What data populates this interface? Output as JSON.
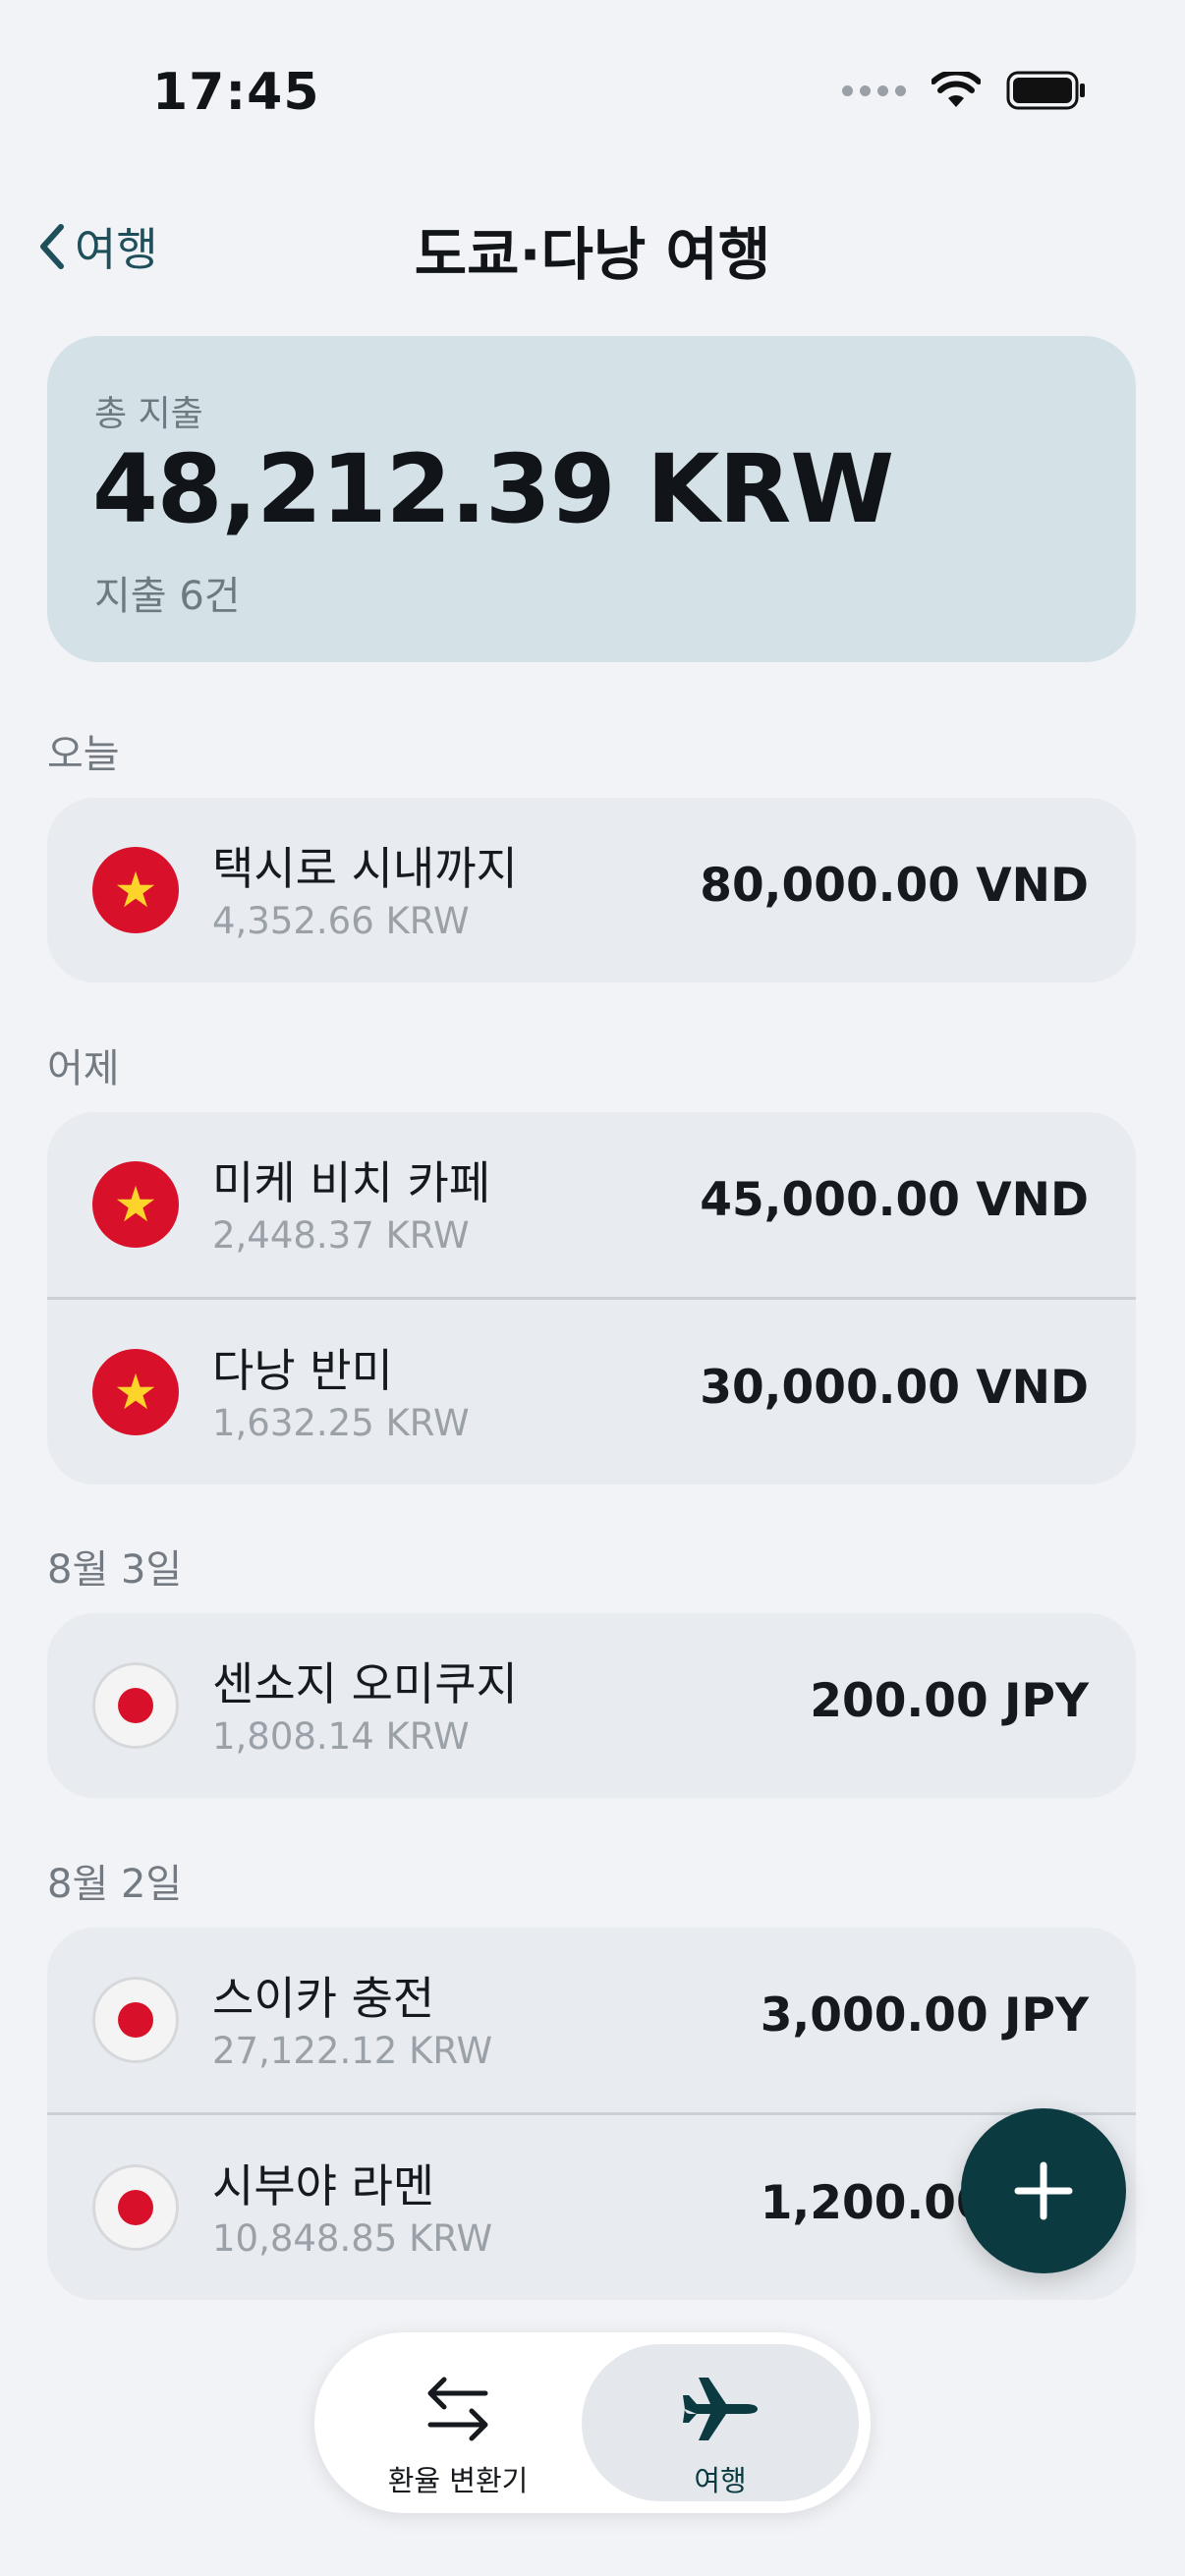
{
  "status_bar": {
    "time": "17:45"
  },
  "nav": {
    "back_label": "여행",
    "title": "도쿄·다낭 여행"
  },
  "summary": {
    "label": "총 지출",
    "total": "48,212.39 KRW",
    "count": "지출 6건"
  },
  "sections": [
    {
      "label": "오늘",
      "items": [
        {
          "flag": "vietnam-flag-icon",
          "title": "택시로 시내까지",
          "converted": "4,352.66 KRW",
          "amount": "80,000.00 VND"
        }
      ]
    },
    {
      "label": "어제",
      "items": [
        {
          "flag": "vietnam-flag-icon",
          "title": "미케 비치 카페",
          "converted": "2,448.37 KRW",
          "amount": "45,000.00 VND"
        },
        {
          "flag": "vietnam-flag-icon",
          "title": "다낭 반미",
          "converted": "1,632.25 KRW",
          "amount": "30,000.00 VND"
        }
      ]
    },
    {
      "label": "8월 3일",
      "items": [
        {
          "flag": "japan-flag-icon",
          "title": "센소지 오미쿠지",
          "converted": "1,808.14 KRW",
          "amount": "200.00 JPY"
        }
      ]
    },
    {
      "label": "8월 2일",
      "items": [
        {
          "flag": "japan-flag-icon",
          "title": "스이카 충전",
          "converted": "27,122.12 KRW",
          "amount": "3,000.00 JPY"
        },
        {
          "flag": "japan-flag-icon",
          "title": "시부야 라멘",
          "converted": "10,848.85 KRW",
          "amount": "1,200.00 JPY"
        }
      ]
    }
  ],
  "fab": {
    "icon": "plus-icon"
  },
  "tab_bar": {
    "tabs": [
      {
        "label": "환율 변환기",
        "icon": "exchange-arrows-icon",
        "selected": false
      },
      {
        "label": "여행",
        "icon": "airplane-icon",
        "selected": true
      }
    ]
  },
  "colors": {
    "accent": "#0b3a40",
    "summary_bg": "#d4e1e6",
    "vn_red": "#d8102a",
    "vn_star": "#ffd42a"
  }
}
